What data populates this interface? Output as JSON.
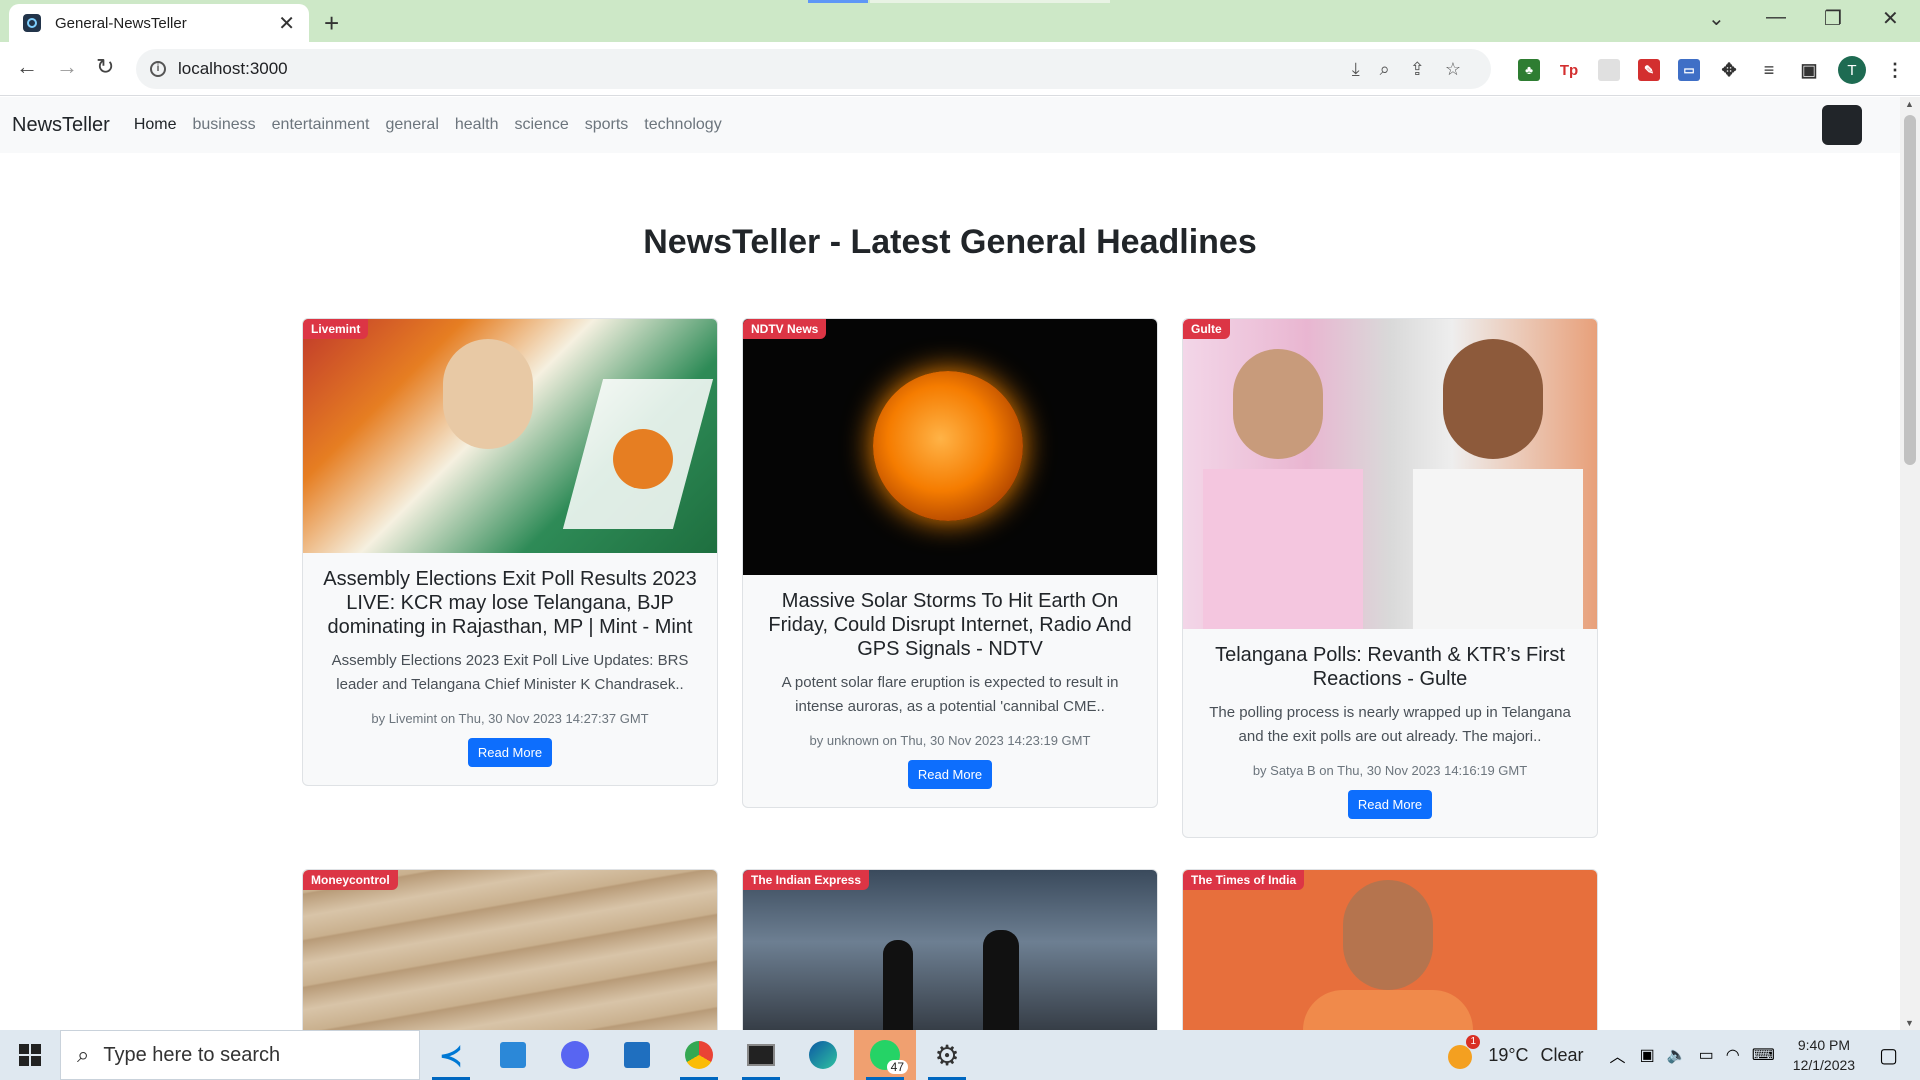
{
  "browser": {
    "tab_title": "General-NewsTeller",
    "url": "localhost:3000",
    "profile_initial": "T"
  },
  "navbar": {
    "brand": "NewsTeller",
    "links": [
      "Home",
      "business",
      "entertainment",
      "general",
      "health",
      "science",
      "sports",
      "technology"
    ],
    "active": "Home"
  },
  "page": {
    "heading": "NewsTeller - Latest General Headlines"
  },
  "articles": [
    {
      "source": "Livemint",
      "title": "Assembly Elections Exit Poll Results 2023 LIVE: KCR may lose Telangana, BJP dominating in Rajasthan, MP | Mint - Mint",
      "description": "Assembly Elections 2023 Exit Poll Live Updates: BRS leader and Telangana Chief Minister K Chandrasek..",
      "meta": "by Livemint on Thu, 30 Nov 2023 14:27:37 GMT",
      "button": "Read More"
    },
    {
      "source": "NDTV News",
      "title": "Massive Solar Storms To Hit Earth On Friday, Could Disrupt Internet, Radio And GPS Signals - NDTV",
      "description": "A potent solar flare eruption is expected to result in intense auroras, as a potential 'cannibal CME..",
      "meta": "by unknown on Thu, 30 Nov 2023 14:23:19 GMT",
      "button": "Read More"
    },
    {
      "source": "Gulte",
      "title": "Telangana Polls: Revanth & KTR’s First Reactions - Gulte",
      "description": "The polling process is nearly wrapped up in Telangana and the exit polls are out already. The majori..",
      "meta": "by Satya B on Thu, 30 Nov 2023 14:16:19 GMT",
      "button": "Read More"
    },
    {
      "source": "Moneycontrol"
    },
    {
      "source": "The Indian Express"
    },
    {
      "source": "The Times of India"
    }
  ],
  "taskbar": {
    "search_placeholder": "Type here to search",
    "whatsapp_badge": "47",
    "weather_badge": "1",
    "temperature": "19°C",
    "weather": "Clear",
    "time": "9:40 PM",
    "date": "12/1/2023"
  }
}
